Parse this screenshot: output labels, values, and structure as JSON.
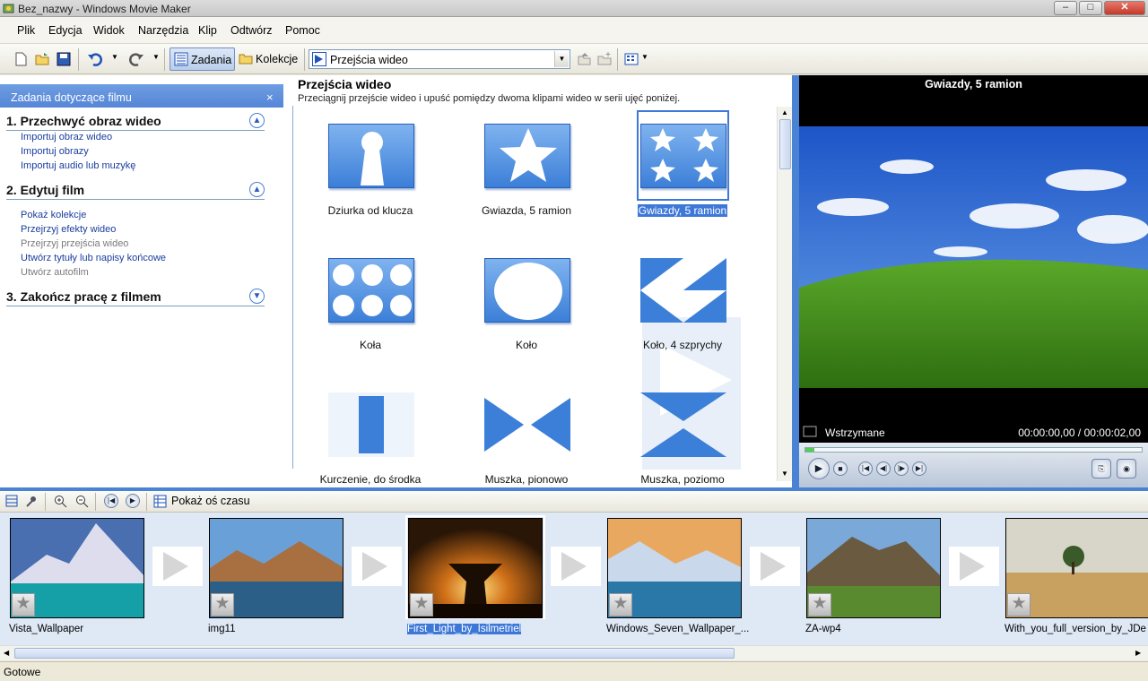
{
  "window": {
    "title": "Bez_nazwy - Windows Movie Maker",
    "min": "–",
    "max": "□",
    "close": "✕"
  },
  "menu": [
    "Plik",
    "Edycja",
    "Widok",
    "Narzędzia",
    "Klip",
    "Odtwórz",
    "Pomoc"
  ],
  "toolbar": {
    "tasks_label": "Zadania",
    "collections_label": "Kolekcje",
    "combo_value": "Przejścia wideo"
  },
  "taskpane": {
    "title": "Zadania dotyczące filmu",
    "close": "×",
    "sections": [
      {
        "title": "1. Przechwyć obraz wideo",
        "links": [
          "Importuj obraz wideo",
          "Importuj obrazy",
          "Importuj audio lub muzykę"
        ]
      },
      {
        "title": "2. Edytuj film",
        "links": [
          "Pokaż kolekcje",
          "Przejrzyj efekty wideo",
          "Przejrzyj przejścia wideo",
          "Utwórz tytuły lub napisy końcowe",
          "Utwórz autofilm"
        ]
      },
      {
        "title": "3. Zakończ pracę z filmem"
      }
    ]
  },
  "transitions": {
    "title": "Przejścia wideo",
    "subtitle": "Przeciągnij przejście wideo i upuść pomiędzy dwoma klipami wideo w serii ujęć poniżej.",
    "items": [
      "Dziurka od klucza",
      "Gwiazda, 5 ramion",
      "Gwiazdy, 5 ramion",
      "Koła",
      "Koło",
      "Koło, 4 szprychy",
      "Kurczenie, do środka",
      "Muszka, pionowo",
      "Muszka, poziomo"
    ],
    "selected_index": 2
  },
  "preview": {
    "title": "Gwiazdy, 5 ramion",
    "status": "Wstrzymane",
    "time": "00:00:00,00 / 00:00:02,00"
  },
  "storyboard": {
    "timeline_label": "Pokaż oś czasu",
    "clips": [
      "Vista_Wallpaper",
      "img11",
      "First_Light_by_Isilmetriel",
      "Windows_Seven_Wallpaper_...",
      "ZA-wp4",
      "With_you_full_version_by_JDe"
    ],
    "selected_index": 2
  },
  "status": "Gotowe"
}
